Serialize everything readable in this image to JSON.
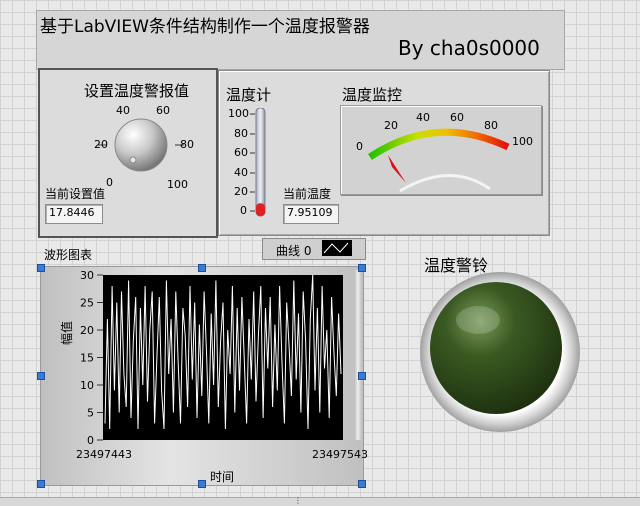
{
  "title": "基于LabVIEW条件结构制作一个温度报警器",
  "author": "By cha0s0000",
  "alarm_setting": {
    "label": "设置温度警报值",
    "knob_ticks": [
      "0",
      "20",
      "40",
      "60",
      "80",
      "100"
    ],
    "current_label": "当前设置值",
    "current_value": "17.8446",
    "knob_value": 17.8446
  },
  "thermometer": {
    "label": "温度计",
    "ticks": [
      "100",
      "80",
      "60",
      "40",
      "20",
      "0"
    ],
    "current_label": "当前温度",
    "current_value": "7.95109",
    "level": 7.95109
  },
  "gauge": {
    "label": "温度监控",
    "ticks": [
      "0",
      "20",
      "40",
      "60",
      "80",
      "100"
    ],
    "value": 7.95109
  },
  "waveform": {
    "label": "波形图表",
    "legend": "曲线 0",
    "ylabel": "幅值",
    "xlabel": "时间",
    "x_start": "23497443",
    "x_end": "23497543",
    "yticks": [
      "30",
      "25",
      "20",
      "15",
      "10",
      "5",
      "0"
    ]
  },
  "alarm_light": {
    "label": "温度警铃",
    "color": "#3a5a22"
  },
  "colors": {
    "accent": "#3a7bd5",
    "thermo_fill": "#e02020",
    "gauge_green": "#22c000",
    "gauge_red": "#e01010"
  },
  "chart_data": {
    "type": "line",
    "title": "",
    "xlabel": "时间",
    "ylabel": "幅值",
    "xlim": [
      23497443,
      23497543
    ],
    "ylim": [
      0,
      30
    ],
    "series": [
      {
        "values": [
          3,
          22,
          2,
          28,
          9,
          25,
          5,
          27,
          12,
          6,
          29,
          4,
          18,
          26,
          2,
          24,
          10,
          28,
          7,
          20,
          27,
          3,
          15,
          26,
          9,
          2,
          29,
          12,
          22,
          5,
          27,
          14,
          3,
          24,
          19,
          6,
          28,
          11,
          25,
          4,
          21,
          8,
          27,
          16,
          3,
          23,
          10,
          29,
          6,
          18,
          25,
          2,
          20,
          12,
          28,
          5,
          24,
          9,
          26,
          15,
          3,
          22,
          11,
          27,
          7,
          19,
          28,
          4,
          24,
          13,
          26,
          6,
          21,
          9,
          28,
          14,
          3,
          25,
          17,
          8,
          29,
          11,
          23,
          5,
          27,
          18,
          2,
          22,
          30,
          9,
          24,
          5,
          28,
          13,
          20,
          4,
          26,
          16,
          8,
          23,
          12
        ]
      }
    ]
  }
}
